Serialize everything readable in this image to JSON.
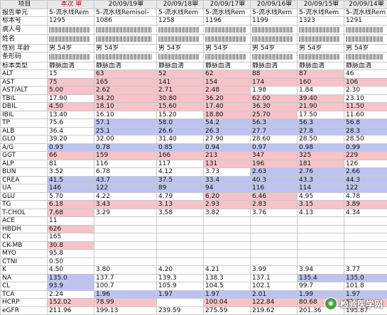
{
  "columns": {
    "item": "项目",
    "current": "本次 审",
    "d1": "20/09/19审",
    "d2": "20/09/18审",
    "d3": "20/09/17审",
    "d4": "20/09/16审",
    "d5": "20/09/15审",
    "d6": "20/09/14审"
  },
  "info_rows": [
    {
      "label": "报告单元",
      "cells": [
        "5-流水线Rem",
        "5-流水线Remisol-",
        "5-流水线Rem",
        "5-流水线Rem",
        "5-流水线Rem",
        "5-流水线Rem",
        "5-流水线Rem"
      ]
    },
    {
      "label": "标本号",
      "cells": [
        "1295",
        "1086",
        "1258",
        "1196",
        "1199",
        "1323",
        "1291"
      ]
    },
    {
      "label": "病人号",
      "cells": [
        "",
        "",
        "",
        "",
        "",
        "",
        ""
      ]
    },
    {
      "label": "姓名",
      "cells": [
        "",
        "",
        "",
        "",
        "",
        "",
        ""
      ]
    },
    {
      "label": "性别 年龄",
      "cells": [
        "男 54岁",
        "男 54岁",
        "男 54岁",
        "男 54岁",
        "男 54岁",
        "男 54岁",
        "男 54岁"
      ]
    },
    {
      "label": "条形码",
      "cells": [
        "",
        "",
        "",
        "",
        "",
        "",
        ""
      ]
    },
    {
      "label": "标本类型",
      "cells": [
        "静脉血清",
        "静脉血清",
        "静脉血清",
        "静脉血清",
        "静脉血清",
        "静脉血清",
        "静脉血清"
      ]
    }
  ],
  "rows": [
    {
      "label": "ALT",
      "cells": [
        [
          "15",
          ""
        ],
        [
          "63",
          "pink"
        ],
        [
          "52",
          "pink"
        ],
        [
          "62",
          "pink"
        ],
        [
          "88",
          "pink"
        ],
        [
          "87",
          "pink"
        ],
        [
          "46",
          ""
        ]
      ]
    },
    {
      "label": "AST",
      "cells": [
        [
          "75",
          "pink"
        ],
        [
          "165",
          "pink"
        ],
        [
          "141",
          "pink"
        ],
        [
          "154",
          "pink"
        ],
        [
          "174",
          "pink"
        ],
        [
          "160",
          "pink"
        ],
        [
          "106",
          "pink"
        ]
      ]
    },
    {
      "label": "AST/ALT",
      "cells": [
        [
          "5.00",
          "pink"
        ],
        [
          "2.62",
          "pink"
        ],
        [
          "2.71",
          "pink"
        ],
        [
          "2.48",
          "pink"
        ],
        [
          "1.98",
          ""
        ],
        [
          "1.84",
          ""
        ],
        [
          "2.30",
          ""
        ]
      ]
    },
    {
      "label": "TBIL",
      "cells": [
        [
          "17.90",
          ""
        ],
        [
          "34.20",
          "pink"
        ],
        [
          "30.80",
          "pink"
        ],
        [
          "36.20",
          "pink"
        ],
        [
          "62.00",
          "pink"
        ],
        [
          "39.40",
          "pink"
        ],
        [
          "23.10",
          ""
        ]
      ]
    },
    {
      "label": "DBIL",
      "cells": [
        [
          "4.50",
          "pink"
        ],
        [
          "18.10",
          "pink"
        ],
        [
          "15.60",
          "pink"
        ],
        [
          "17.40",
          "pink"
        ],
        [
          "36.30",
          "pink"
        ],
        [
          "21.90",
          "pink"
        ],
        [
          "11.50",
          "pink"
        ]
      ]
    },
    {
      "label": "IBIL",
      "cells": [
        [
          "13.40",
          ""
        ],
        [
          "16.10",
          ""
        ],
        [
          "15.20",
          ""
        ],
        [
          "18.80",
          "pink"
        ],
        [
          "25.70",
          "pink"
        ],
        [
          "17.50",
          ""
        ],
        [
          "11.60",
          ""
        ]
      ]
    },
    {
      "label": "TP",
      "cells": [
        [
          "75.6",
          ""
        ],
        [
          "57.1",
          "blue"
        ],
        [
          "58.0",
          "blue"
        ],
        [
          "54.2",
          "blue"
        ],
        [
          "56.3",
          "blue"
        ],
        [
          "56.3",
          "blue"
        ],
        [
          "56.8",
          "blue"
        ]
      ]
    },
    {
      "label": "ALB",
      "cells": [
        [
          "36.4",
          ""
        ],
        [
          "25.1",
          "blue"
        ],
        [
          "26.6",
          "blue"
        ],
        [
          "26.3",
          "blue"
        ],
        [
          "27.7",
          "blue"
        ],
        [
          "27.8",
          "blue"
        ],
        [
          "28.3",
          "blue"
        ]
      ]
    },
    {
      "label": "GLO",
      "cells": [
        [
          "39.20",
          ""
        ],
        [
          "32.00",
          ""
        ],
        [
          "31.40",
          ""
        ],
        [
          "27.90",
          ""
        ],
        [
          "28.60",
          ""
        ],
        [
          "28.50",
          ""
        ],
        [
          "28.50",
          ""
        ]
      ]
    },
    {
      "label": "A/G",
      "cells": [
        [
          "0.93",
          "blue"
        ],
        [
          "0.78",
          "blue"
        ],
        [
          "0.85",
          "blue"
        ],
        [
          "0.94",
          "blue"
        ],
        [
          "0.97",
          "blue"
        ],
        [
          "0.98",
          "blue"
        ],
        [
          "0.99",
          "blue"
        ]
      ]
    },
    {
      "label": "GGT",
      "cells": [
        [
          "66",
          "pink"
        ],
        [
          "159",
          "pink"
        ],
        [
          "166",
          "pink"
        ],
        [
          "213",
          "pink"
        ],
        [
          "347",
          "pink"
        ],
        [
          "325",
          "pink"
        ],
        [
          "229",
          "pink"
        ]
      ]
    },
    {
      "label": "ALP",
      "cells": [
        [
          "81",
          ""
        ],
        [
          "116",
          ""
        ],
        [
          "117",
          ""
        ],
        [
          "131",
          "pink"
        ],
        [
          "196",
          "pink"
        ],
        [
          "181",
          "pink"
        ],
        [
          "126",
          ""
        ]
      ]
    },
    {
      "label": "BUN",
      "cells": [
        [
          "3.52",
          ""
        ],
        [
          "6.78",
          ""
        ],
        [
          "4.12",
          ""
        ],
        [
          "3.73",
          ""
        ],
        [
          "2.63",
          "blue"
        ],
        [
          "2.76",
          "blue"
        ],
        [
          "2.66",
          "blue"
        ]
      ]
    },
    {
      "label": "CREA",
      "cells": [
        [
          "41.5",
          "blue"
        ],
        [
          "43.7",
          "blue"
        ],
        [
          "37.5",
          "blue"
        ],
        [
          "33.4",
          "blue"
        ],
        [
          "40.3",
          "blue"
        ],
        [
          "43.3",
          "blue"
        ],
        [
          "44.3",
          "blue"
        ]
      ]
    },
    {
      "label": "UA",
      "cells": [
        [
          "146",
          "blue"
        ],
        [
          "122",
          "blue"
        ],
        [
          "89",
          "blue"
        ],
        [
          "94",
          "blue"
        ],
        [
          "116",
          "blue"
        ],
        [
          "114",
          "blue"
        ],
        [
          "122",
          "blue"
        ]
      ]
    },
    {
      "label": "GLU",
      "cells": [
        [
          "5.70",
          ""
        ],
        [
          "4.22",
          ""
        ],
        [
          "4.79",
          ""
        ],
        [
          "6.20",
          "pink"
        ],
        [
          "6.46",
          "pink"
        ],
        [
          "4.95",
          ""
        ],
        [
          "4.78",
          ""
        ]
      ]
    },
    {
      "label": "TG",
      "cells": [
        [
          "6.18",
          "pink"
        ],
        [
          "3.43",
          "pink"
        ],
        [
          "3.13",
          "pink"
        ],
        [
          "2.93",
          "pink"
        ],
        [
          "2.83",
          "pink"
        ],
        [
          "3.15",
          "pink"
        ],
        [
          "3.89",
          "pink"
        ]
      ]
    },
    {
      "label": "T-CHOL",
      "cells": [
        [
          "7.68",
          "pink"
        ],
        [
          "3.29",
          ""
        ],
        [
          "3.58",
          ""
        ],
        [
          "3.82",
          ""
        ],
        [
          "3.76",
          ""
        ],
        [
          "4.13",
          ""
        ],
        [
          "4.34",
          ""
        ]
      ]
    },
    {
      "label": "ACE",
      "cells": [
        [
          "11",
          ""
        ],
        [
          "",
          ""
        ],
        [
          "",
          ""
        ],
        [
          "",
          ""
        ],
        [
          "",
          ""
        ],
        [
          "",
          ""
        ],
        [
          "",
          ""
        ]
      ]
    },
    {
      "label": "HBDH",
      "cells": [
        [
          "626",
          "pink"
        ],
        [
          "",
          ""
        ],
        [
          "",
          ""
        ],
        [
          "",
          ""
        ],
        [
          "",
          ""
        ],
        [
          "",
          ""
        ],
        [
          "",
          ""
        ]
      ]
    },
    {
      "label": "CK",
      "cells": [
        [
          "165",
          ""
        ],
        [
          "",
          ""
        ],
        [
          "",
          ""
        ],
        [
          "",
          ""
        ],
        [
          "",
          ""
        ],
        [
          "",
          ""
        ],
        [
          "",
          ""
        ]
      ]
    },
    {
      "label": "CK-MB",
      "cells": [
        [
          "30.8",
          "pink"
        ],
        [
          "",
          ""
        ],
        [
          "",
          ""
        ],
        [
          "",
          ""
        ],
        [
          "",
          ""
        ],
        [
          "",
          ""
        ],
        [
          "",
          ""
        ]
      ]
    },
    {
      "label": "MYO",
      "cells": [
        [
          "95.8",
          ""
        ],
        [
          "",
          ""
        ],
        [
          "",
          ""
        ],
        [
          "",
          ""
        ],
        [
          "",
          ""
        ],
        [
          "",
          ""
        ],
        [
          "",
          ""
        ]
      ]
    },
    {
      "label": "CTNI",
      "cells": [
        [
          "0.50",
          ""
        ],
        [
          "",
          ""
        ],
        [
          "",
          ""
        ],
        [
          "",
          ""
        ],
        [
          "",
          ""
        ],
        [
          "",
          ""
        ],
        [
          "",
          ""
        ]
      ]
    },
    {
      "label": "K",
      "cells": [
        [
          "4.50",
          ""
        ],
        [
          "3.80",
          ""
        ],
        [
          "4.20",
          ""
        ],
        [
          "4.21",
          ""
        ],
        [
          "3.99",
          ""
        ],
        [
          "3.94",
          ""
        ],
        [
          "3.77",
          ""
        ]
      ]
    },
    {
      "label": "NA",
      "cells": [
        [
          "135.0",
          "blue"
        ],
        [
          "137.7",
          ""
        ],
        [
          "139.3",
          ""
        ],
        [
          "138.3",
          ""
        ],
        [
          "137.1",
          ""
        ],
        [
          "135.4",
          "blue"
        ],
        [
          "135.0",
          "blue"
        ]
      ]
    },
    {
      "label": "CL",
      "cells": [
        [
          "93.9",
          "blue"
        ],
        [
          "100.7",
          ""
        ],
        [
          "105.9",
          ""
        ],
        [
          "104.5",
          ""
        ],
        [
          "102.1",
          ""
        ],
        [
          "99.7",
          ""
        ],
        [
          "101.8",
          ""
        ]
      ]
    },
    {
      "label": "TCA",
      "cells": [
        [
          "2.24",
          ""
        ],
        [
          "1.96",
          "blue"
        ],
        [
          "1.97",
          "blue"
        ],
        [
          "1.97",
          "blue"
        ],
        [
          "2.01",
          "blue"
        ],
        [
          "1.99",
          "blue"
        ],
        [
          "1.97",
          "blue"
        ]
      ]
    },
    {
      "label": "HCRP",
      "cells": [
        [
          "152.02",
          "pink"
        ],
        [
          "78.99",
          "pink"
        ],
        [
          "",
          ""
        ],
        [
          "100.04",
          "pink"
        ],
        [
          "122.84",
          "pink"
        ],
        [
          "80.68",
          "pink"
        ],
        [
          "61.16",
          "pink"
        ]
      ]
    },
    {
      "label": "eGFR",
      "cells": [
        [
          "211.96",
          ""
        ],
        [
          "199.13",
          ""
        ],
        [
          "239.59",
          ""
        ],
        [
          "275.59",
          ""
        ],
        [
          "219.62",
          ""
        ],
        [
          "201.36",
          ""
        ],
        [
          "195.87",
          ""
        ]
      ]
    }
  ],
  "watermark": {
    "icon": "wechat-icon",
    "text": "检验医学网"
  }
}
